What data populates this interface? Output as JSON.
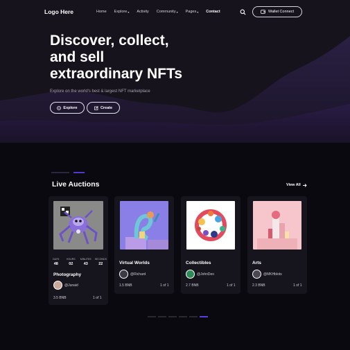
{
  "header": {
    "logo": "Logo Here",
    "menu": [
      {
        "label": "Home",
        "caret": false
      },
      {
        "label": "Explore",
        "caret": true
      },
      {
        "label": "Activity",
        "caret": false
      },
      {
        "label": "Community",
        "caret": true
      },
      {
        "label": "Pages",
        "caret": true
      },
      {
        "label": "Contact",
        "caret": false
      }
    ],
    "wallet_label": "Wallet Connect"
  },
  "hero": {
    "title_line1": "Discover, collect,",
    "title_line2": "and sell",
    "title_line3": "extraordinary NFTs",
    "subtitle": "Explore on the world's best & largest NFT marketplace",
    "explore_label": "Explore",
    "create_label": "Create"
  },
  "auctions": {
    "title": "Live Auctions",
    "view_all": "View All",
    "timer_labels": [
      "DAYS",
      "HOURS",
      "MINUTES",
      "SECONDS"
    ],
    "timer_values": [
      "48",
      "02",
      "43",
      "22"
    ],
    "cards": [
      {
        "title": "Photography",
        "owner": "@Junaid",
        "price": "3.5 BNB",
        "edition": "1 of 1"
      },
      {
        "title": "Virtual Worlds",
        "owner": "@Richard",
        "price": "1.5 BNB",
        "edition": "1 of 1"
      },
      {
        "title": "Collectibles",
        "owner": "@JohnDeo",
        "price": "2.7 BNB",
        "edition": "1 of 1"
      },
      {
        "title": "Arts",
        "owner": "@MKHblots",
        "price": "2.3 BNB",
        "edition": "1 of 1"
      }
    ]
  },
  "carousel": {
    "active_index": 5,
    "count": 6
  },
  "colors": {
    "accent": "#5a40e0",
    "background": "#0b0910",
    "hero": "#16131c",
    "card": "#16141c"
  },
  "icons": {
    "search": "search-icon",
    "wallet": "wallet-icon",
    "explore": "compass-icon",
    "create": "edit-icon",
    "arrow": "arrow-right-icon"
  }
}
